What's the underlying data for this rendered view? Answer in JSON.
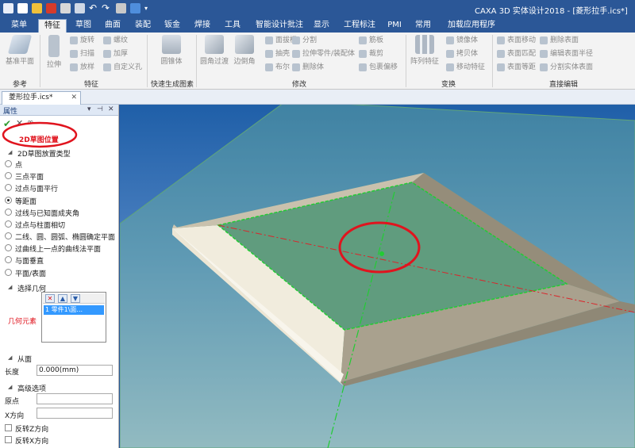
{
  "titlebar": {
    "title": "CAXA 3D 实体设计2018 - [菱形拉手.ics*]",
    "quick_access": [
      "new-icon",
      "open-icon",
      "close-doc-icon",
      "save-icon",
      "undo-icon",
      "redo-icon",
      "design-element-icon",
      "snap-icon"
    ]
  },
  "tabs": [
    "菜单",
    "特征",
    "草图",
    "曲面",
    "装配",
    "钣金",
    "焊接",
    "工具",
    "智能设计批注",
    "显示",
    "工程标注",
    "PMI",
    "常用",
    "加载应用程序"
  ],
  "active_tab": "特征",
  "ribbon": {
    "groups": {
      "reference": "参考",
      "feature": "特征",
      "quick": "快速生成图素",
      "modify": "修改",
      "transform": "变换",
      "direct_edit": "直接编辑"
    },
    "ref_plane": "基准平面",
    "pull": "拉伸",
    "rotate": "旋转",
    "sweep": "扫描",
    "loft": "放样",
    "thread": "螺纹",
    "thicken": "加厚",
    "custom_hole": "自定义孔",
    "cone": "圆锥体",
    "fillet": "圆角过渡",
    "chamfer": "边倒角",
    "draft": "面拔模",
    "shell": "抽壳",
    "boolean": "布尔",
    "split": "分割",
    "pull_part": "拉伸零件/装配体",
    "delete_body": "删除体",
    "rib": "筋板",
    "trim": "裁剪",
    "wrap": "包裹偏移",
    "pattern": "阵列特征",
    "mirror": "镜像体",
    "copy": "拷贝体",
    "transform_feature": "移动特征",
    "face_move": "表面移动",
    "face_match": "表面匹配",
    "face_offset": "表面等距",
    "delete_face": "删除表面",
    "edit_radius": "编辑表面半径",
    "split_face": "分割实体表面"
  },
  "document": {
    "tab": "菱形拉手.ics*"
  },
  "panel": {
    "title": "属性",
    "section_2d": "2D草图位置",
    "placement_type": "2D草图放置类型",
    "options": [
      "点",
      "三点平面",
      "过点与面平行",
      "等距面",
      "过线与已知面成夹角",
      "过点与柱面相切",
      "二线、圆、圆弧、椭圆确定平面",
      "过曲线上一点的曲线法平面",
      "与面垂直",
      "平面/表面"
    ],
    "selected_option": 3,
    "select_geometry": "选择几何",
    "geometry_label": "几何元素",
    "geometry_item": "1 零件1\\面...",
    "from_face": "从面",
    "length_label": "长度",
    "length_value": "0.000(mm)",
    "advanced": "高级选项",
    "origin_label": "原点",
    "xdir_label": "X方向",
    "reverse_z": "反转Z方向",
    "reverse_x": "反转X方向"
  },
  "colors": {
    "title_bg": "#2b5797",
    "ribbon_bg": "#f3f3f3",
    "annotation_red": "#e0141e",
    "sketch_green": "#22cc33",
    "plane_green": "#7fc79a",
    "part_beige": "#ede6d4"
  }
}
